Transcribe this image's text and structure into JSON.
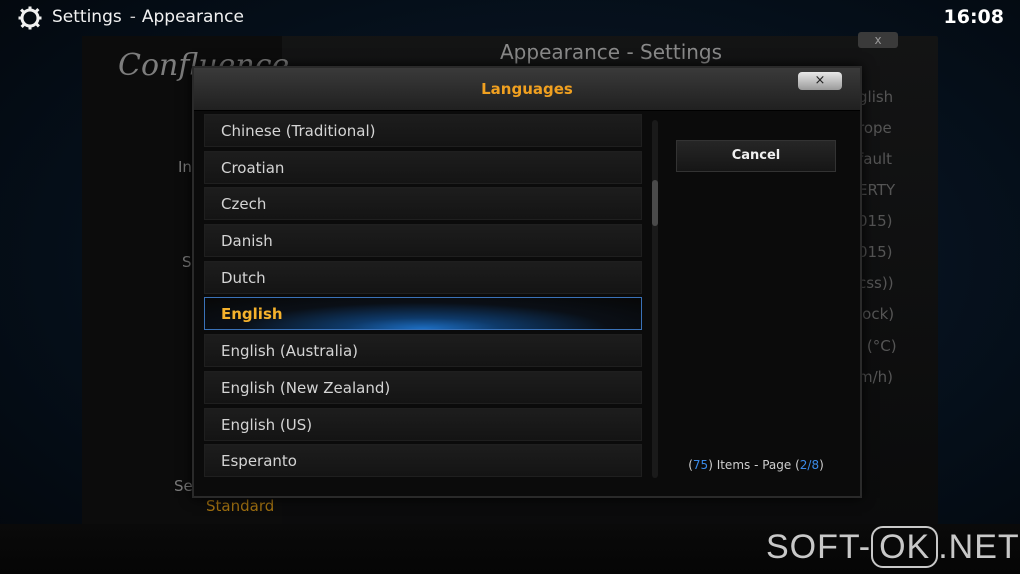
{
  "header": {
    "section": "Settings",
    "subsection": "Appearance",
    "separator": "-",
    "clock": "16:08"
  },
  "background": {
    "logo": "Confluence",
    "window_title": "Appearance - Settings",
    "close_label": "x",
    "sidebar_fragments": [
      "In",
      "S",
      "Se"
    ],
    "standard_value": "Standard",
    "value_fragments": [
      "glish",
      "rope",
      "fault",
      "ERTY",
      "015)",
      "015)",
      "css))",
      "lock)",
      "l (°C)",
      "m/h)"
    ]
  },
  "dialog": {
    "title": "Languages",
    "close_label": "×",
    "items": [
      {
        "label": "Chinese (Traditional)",
        "selected": false
      },
      {
        "label": "Croatian",
        "selected": false
      },
      {
        "label": "Czech",
        "selected": false
      },
      {
        "label": "Danish",
        "selected": false
      },
      {
        "label": "Dutch",
        "selected": false
      },
      {
        "label": "English",
        "selected": true
      },
      {
        "label": "English (Australia)",
        "selected": false
      },
      {
        "label": "English (New Zealand)",
        "selected": false
      },
      {
        "label": "English (US)",
        "selected": false
      },
      {
        "label": "Esperanto",
        "selected": false
      }
    ],
    "cancel_label": "Cancel",
    "page_info": {
      "item_count": "75",
      "items_text": "Items - Page",
      "page": "2/8"
    }
  },
  "watermark": {
    "prefix": "SOFT-",
    "mid": "OK",
    "suffix": ".NET"
  },
  "colors": {
    "accent": "#f0a020",
    "selection_blue": "#1d6fc4",
    "info_blue": "#3a8ae8"
  },
  "icons": {
    "settings": "gear-icon",
    "close": "close-icon"
  }
}
